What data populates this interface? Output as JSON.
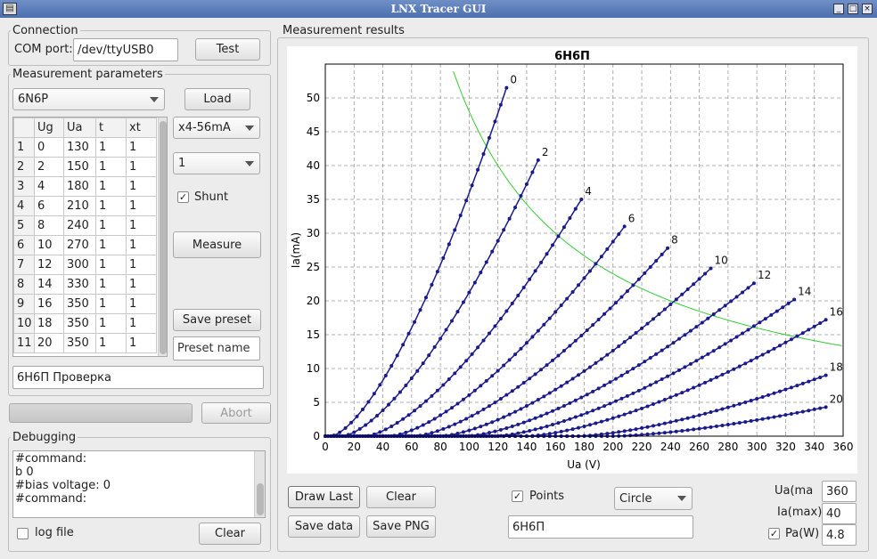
{
  "window": {
    "title": "LNX Tracer GUI",
    "app_icon": "tube-icon",
    "controls": [
      "minimize-icon",
      "maximize-icon",
      "close-icon"
    ]
  },
  "connection": {
    "title": "Connection",
    "com_label": "COM port:",
    "com_value": "/dev/ttyUSB0",
    "test_label": "Test"
  },
  "params": {
    "title": "Measurement parameters",
    "tube_select": "6N6P",
    "load_label": "Load",
    "columns": [
      "Ug",
      "Ua",
      "t",
      "xt"
    ],
    "rows": [
      {
        "n": "1",
        "ug": "0",
        "ua": "130",
        "t": "1",
        "xt": "1"
      },
      {
        "n": "2",
        "ug": "2",
        "ua": "150",
        "t": "1",
        "xt": "1"
      },
      {
        "n": "3",
        "ug": "4",
        "ua": "180",
        "t": "1",
        "xt": "1"
      },
      {
        "n": "4",
        "ug": "6",
        "ua": "210",
        "t": "1",
        "xt": "1"
      },
      {
        "n": "5",
        "ug": "8",
        "ua": "240",
        "t": "1",
        "xt": "1"
      },
      {
        "n": "6",
        "ug": "10",
        "ua": "270",
        "t": "1",
        "xt": "1"
      },
      {
        "n": "7",
        "ug": "12",
        "ua": "300",
        "t": "1",
        "xt": "1"
      },
      {
        "n": "8",
        "ug": "14",
        "ua": "330",
        "t": "1",
        "xt": "1"
      },
      {
        "n": "9",
        "ug": "16",
        "ua": "350",
        "t": "1",
        "xt": "1"
      },
      {
        "n": "10",
        "ug": "18",
        "ua": "350",
        "t": "1",
        "xt": "1"
      },
      {
        "n": "11",
        "ug": "20",
        "ua": "350",
        "t": "1",
        "xt": "1"
      }
    ],
    "range_select": "x4-56mA",
    "avg_select": "1",
    "shunt_label": "Shunt",
    "shunt_checked": true,
    "measure_label": "Measure",
    "save_preset_label": "Save preset",
    "preset_name_placeholder": "Preset name",
    "description": "6Н6П Проверка"
  },
  "progress": {
    "value": 0,
    "abort_label": "Abort"
  },
  "debug": {
    "title": "Debugging",
    "lines": [
      "#command:",
      "b 0",
      "#bias voltage: 0",
      "#command:"
    ],
    "log_label": "log file",
    "log_checked": false,
    "clear_label": "Clear"
  },
  "results": {
    "title": "Measurement results",
    "draw_last_label": "Draw Last",
    "clear_label": "Clear",
    "save_data_label": "Save data",
    "save_png_label": "Save PNG",
    "points_label": "Points",
    "points_checked": true,
    "marker_select": "Circle",
    "chart_title_value": "6Н6П",
    "ua_max_label": "Ua(ma",
    "ua_max_value": "360",
    "ia_max_label": "Ia(max)",
    "ia_max_value": "40",
    "pa_label": "Pa(W)",
    "pa_checked": true,
    "pa_value": "4.8"
  },
  "colors": {
    "curve": "#1a1a8c",
    "pmax": "#33cc33",
    "titlebar": "#5577b8"
  },
  "chart_data": {
    "type": "line",
    "title": "6Н6П",
    "xlabel": "Ua (V)",
    "ylabel": "Ia(mA)",
    "xlim": [
      0,
      360
    ],
    "ylim": [
      0,
      55
    ],
    "xticks": [
      0,
      20,
      40,
      60,
      80,
      100,
      120,
      140,
      160,
      180,
      200,
      220,
      240,
      260,
      280,
      300,
      320,
      340,
      360
    ],
    "yticks": [
      0,
      5,
      10,
      15,
      20,
      25,
      30,
      35,
      40,
      45,
      50
    ],
    "grid": true,
    "series": [
      {
        "name": "0",
        "ua_end": 126,
        "ia_end": 51.5,
        "onset": 4
      },
      {
        "name": "2",
        "ua_end": 148,
        "ia_end": 40.8,
        "onset": 12
      },
      {
        "name": "4",
        "ua_end": 178,
        "ia_end": 35.0,
        "onset": 28
      },
      {
        "name": "6",
        "ua_end": 208,
        "ia_end": 31.0,
        "onset": 45
      },
      {
        "name": "8",
        "ua_end": 238,
        "ia_end": 27.8,
        "onset": 62
      },
      {
        "name": "10",
        "ua_end": 268,
        "ia_end": 24.8,
        "onset": 80
      },
      {
        "name": "12",
        "ua_end": 298,
        "ia_end": 22.6,
        "onset": 98
      },
      {
        "name": "14",
        "ua_end": 326,
        "ia_end": 20.2,
        "onset": 118
      },
      {
        "name": "16",
        "ua_end": 348,
        "ia_end": 17.2,
        "onset": 140
      },
      {
        "name": "18",
        "ua_end": 348,
        "ia_end": 9.0,
        "onset": 175
      },
      {
        "name": "20",
        "ua_end": 348,
        "ia_end": 4.3,
        "onset": 200
      }
    ],
    "pmax_watts": 4.8
  }
}
